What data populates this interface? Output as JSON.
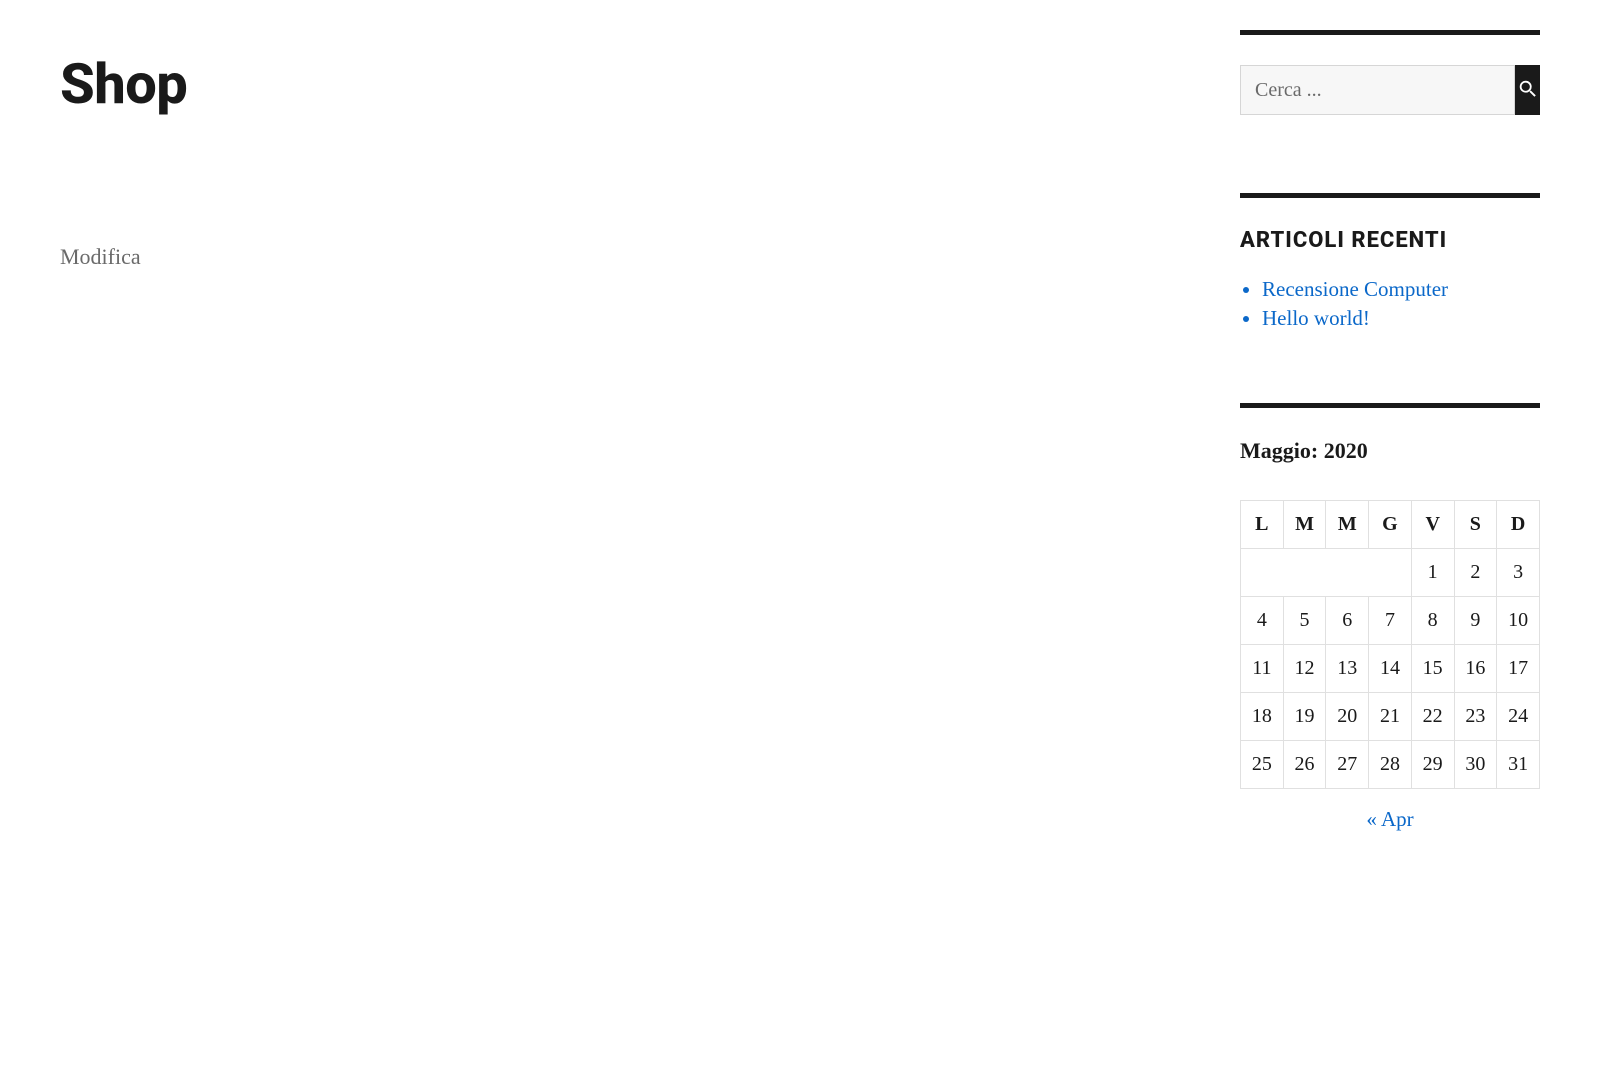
{
  "main": {
    "title": "Shop",
    "edit_link": "Modifica"
  },
  "sidebar": {
    "search": {
      "placeholder": "Cerca ..."
    },
    "recent": {
      "title": "ARTICOLI RECENTI",
      "items": [
        "Recensione Computer",
        "Hello world!"
      ]
    },
    "calendar": {
      "caption": "Maggio: 2020",
      "weekdays": [
        "L",
        "M",
        "M",
        "G",
        "V",
        "S",
        "D"
      ],
      "weeks": [
        [
          "",
          "",
          "",
          "",
          "1",
          "2",
          "3"
        ],
        [
          "4",
          "5",
          "6",
          "7",
          "8",
          "9",
          "10"
        ],
        [
          "11",
          "12",
          "13",
          "14",
          "15",
          "16",
          "17"
        ],
        [
          "18",
          "19",
          "20",
          "21",
          "22",
          "23",
          "24"
        ],
        [
          "25",
          "26",
          "27",
          "28",
          "29",
          "30",
          "31"
        ]
      ],
      "prev_link": "« Apr"
    }
  }
}
